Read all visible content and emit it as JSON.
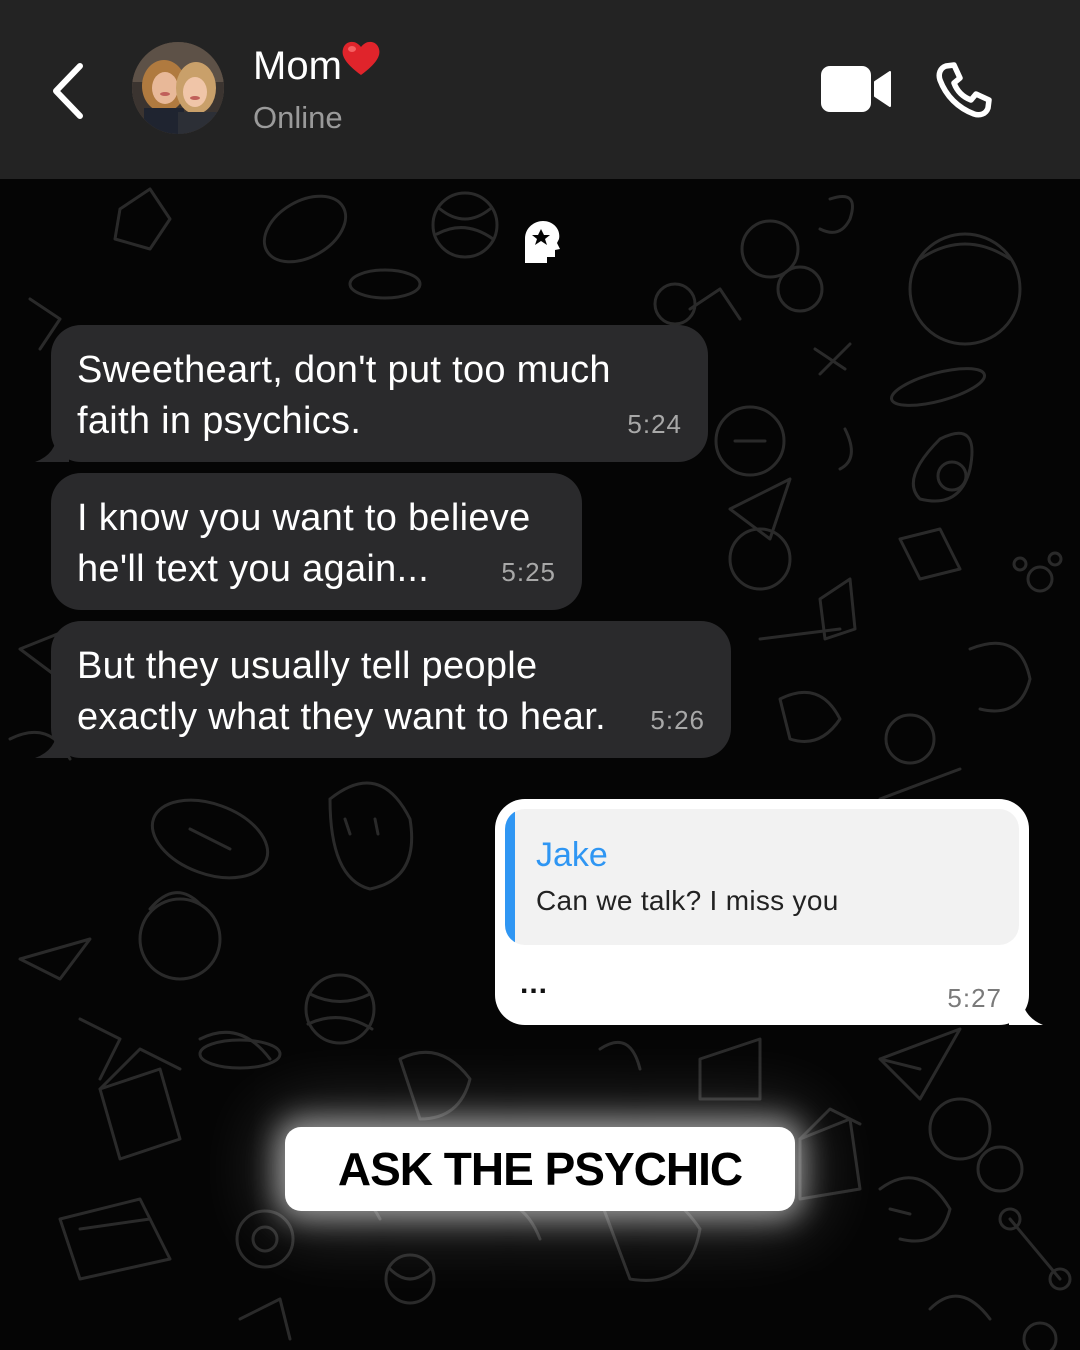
{
  "header": {
    "contact_name": "Mom",
    "contact_status": "Online",
    "icons": {
      "back": "chevron-left-icon",
      "avatar": "avatar-photo",
      "heart": "red-heart-emoji",
      "video": "video-camera-icon",
      "call": "phone-icon"
    }
  },
  "chat": {
    "brand_icon": "psychic-head-logo",
    "messages": [
      {
        "direction": "incoming",
        "text_line1": "Sweetheart, don't put too much",
        "text_line2": "faith in psychics.",
        "time": "5:24"
      },
      {
        "direction": "incoming",
        "text_line1": "I know you want to believe",
        "text_line2": "he'll text you again...",
        "time": "5:25"
      },
      {
        "direction": "incoming",
        "text_line1": "But they usually tell people",
        "text_line2": "exactly what they want to hear.",
        "time": "5:26"
      },
      {
        "direction": "outgoing",
        "quote_sender": "Jake",
        "quote_text": "Can we talk? I miss you",
        "body": "...",
        "time": "5:27"
      }
    ]
  },
  "cta": {
    "label": "ASK THE PSYCHIC"
  },
  "colors": {
    "header_bg": "#232323",
    "chat_bg": "#050505",
    "incoming_bubble": "#2a2a2c",
    "outgoing_bubble": "#ffffff",
    "quote_accent": "#2f96f3",
    "heart": "#e0242b"
  }
}
